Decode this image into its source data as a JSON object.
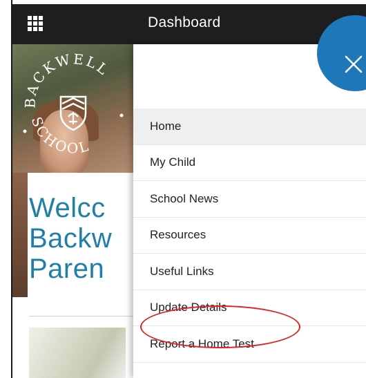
{
  "header": {
    "title": "Dashboard",
    "menu_icon": "apps-grid-icon"
  },
  "background_page": {
    "crest_text_top": "BACKWELL",
    "crest_text_bottom": "SCHOOL",
    "welcome_lines": [
      "Welcc",
      "Backw",
      "Paren"
    ]
  },
  "drawer": {
    "close_icon": "close-icon",
    "items": [
      {
        "label": "Home",
        "active": true
      },
      {
        "label": "My Child",
        "active": false
      },
      {
        "label": "School News",
        "active": false
      },
      {
        "label": "Resources",
        "active": false
      },
      {
        "label": "Useful Links",
        "active": false
      },
      {
        "label": "Update Details",
        "active": false
      },
      {
        "label": "Report a Home Test",
        "active": false,
        "highlighted": true
      }
    ]
  },
  "colors": {
    "header_bg": "#1d1e20",
    "accent_blue": "#1e77b8",
    "welcome_text": "#1f7fa8",
    "highlight_ring": "#e02020"
  }
}
